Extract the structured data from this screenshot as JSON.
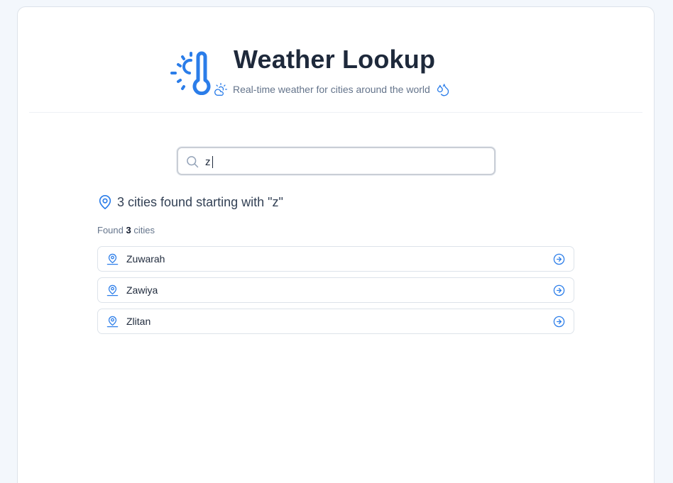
{
  "header": {
    "title": "Weather Lookup",
    "subtitle": "Real-time weather for cities around the world",
    "logo_icon": "thermometer-sun-icon",
    "left_icon": "cloud-sun-icon",
    "right_icon": "droplets-icon"
  },
  "search": {
    "value": "z",
    "icon": "search-icon"
  },
  "results": {
    "heading": "3 cities found starting with \"z\"",
    "found_prefix": "Found",
    "found_count": "3",
    "found_suffix": "cities",
    "items": [
      {
        "name": "Zuwarah"
      },
      {
        "name": "Zawiya"
      },
      {
        "name": "Zlitan"
      }
    ]
  },
  "colors": {
    "accent": "#2b7de9",
    "title": "#1e293b",
    "muted": "#64748b",
    "border": "#dde3ea",
    "background": "#f3f7fc"
  }
}
